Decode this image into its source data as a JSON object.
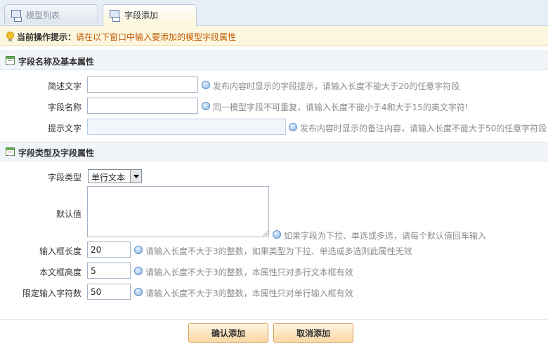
{
  "tabs": [
    {
      "label": "模型列表",
      "active": false
    },
    {
      "label": "字段添加",
      "active": true
    }
  ],
  "tip": {
    "label": "当前操作提示：",
    "message": "请在以下窗口中输入要添加的模型字段属性"
  },
  "section1": {
    "title": "字段名称及基本属性",
    "fields": {
      "description": {
        "label": "简述文字",
        "value": "",
        "hint": "发布内容时显示的字段提示，请输入长度不能大于20的任意字符段"
      },
      "name": {
        "label": "字段名称",
        "value": "",
        "hint": "同一模型字段不可重复，请输入长度不能小于4和大于15的英文字符!"
      },
      "prompt": {
        "label": "提示文字",
        "value": "",
        "hint": "发布内容时显示的备注内容，请输入长度不能大于50的任意字符段"
      }
    }
  },
  "section2": {
    "title": "字段类型及字段属性",
    "fields": {
      "type": {
        "label": "字段类型",
        "selected": "单行文本"
      },
      "default": {
        "label": "默认值",
        "value": "",
        "hint": "如果字段为下拉、单选或多选，请每个默认值回车输入"
      },
      "input_length": {
        "label": "输入框长度",
        "value": "20",
        "hint": "请输入长度不大于3的整数，如果类型为下拉、单选或多选则此属性无效"
      },
      "textarea_height": {
        "label": "本文框高度",
        "value": "5",
        "hint": "请输入长度不大于3的整数，本属性只对多行文本框有效"
      },
      "max_chars": {
        "label": "限定输入字符数",
        "value": "50",
        "hint": "请输入长度不大于3的整数，本属性只对单行输入框有效"
      }
    }
  },
  "buttons": {
    "confirm": "确认添加",
    "cancel": "取消添加"
  },
  "colors": {
    "tip_message": "#c05a00",
    "hint": "#8a8a8a",
    "button_border": "#d79a52"
  }
}
